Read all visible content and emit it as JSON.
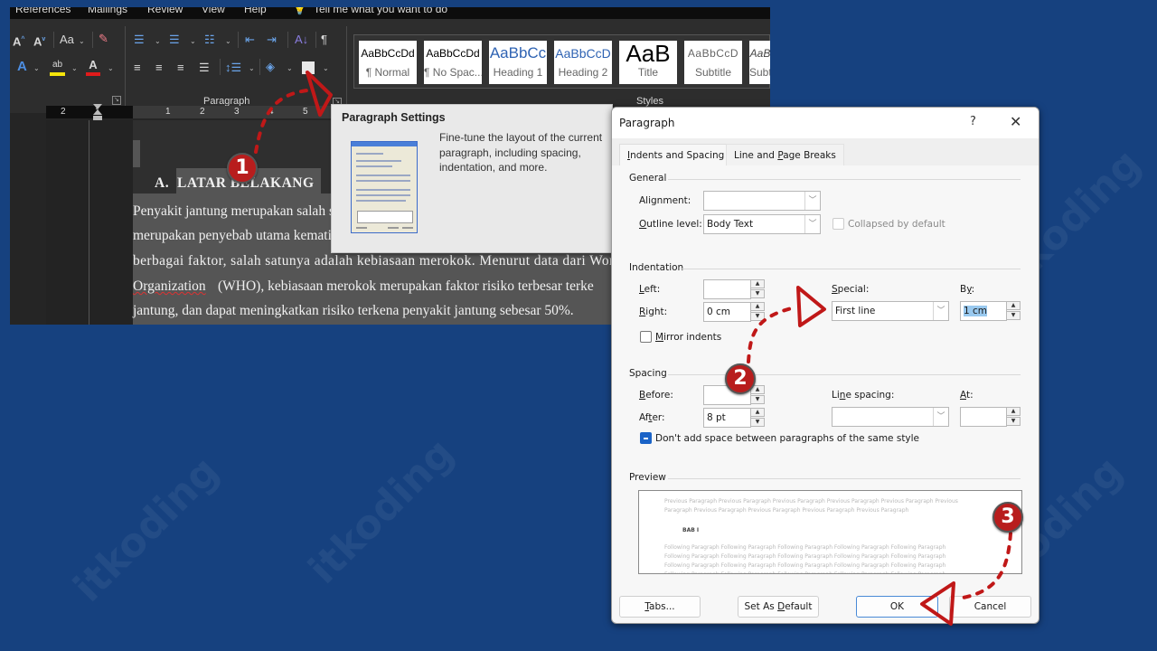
{
  "colors": {
    "background": "#16417f",
    "annotation_red": "#b81d1d",
    "selection_highlight": "#99c9ef",
    "checkbox_accent": "#1a63c7"
  },
  "watermark": "itkoding",
  "word": {
    "menu": [
      "References",
      "Mailings",
      "Review",
      "View",
      "Help",
      "Tell me what you want to do"
    ],
    "ribbon": {
      "font_group_icons": [
        "grow-font-icon",
        "shrink-font-icon",
        "change-case-icon",
        "clear-formatting-icon",
        "text-effects-icon",
        "highlight-color-icon",
        "font-color-icon"
      ],
      "change_case_label": "Aa",
      "paragraph_group_label": "Paragraph",
      "styles_group_label": "Styles",
      "styles": [
        {
          "sample": "AaBbCcDd",
          "name": "¶ Normal"
        },
        {
          "sample": "AaBbCcDd",
          "name": "¶ No Spac..."
        },
        {
          "sample": "AaBbCc",
          "name": "Heading 1"
        },
        {
          "sample": "AaBbCcD",
          "name": "Heading 2"
        },
        {
          "sample": "AaB",
          "name": "Title"
        },
        {
          "sample": "AaBbCcD",
          "name": "Subtitle"
        },
        {
          "sample": "AaB",
          "name": "Subt"
        }
      ]
    },
    "ruler_ticks": [
      "2",
      "1",
      "1",
      "2",
      "3",
      "4",
      "5"
    ],
    "document": {
      "heading_prefix": "A.",
      "heading": "LATAR BELAKANG",
      "lines": [
        "Penyakit jantung merupakan salah satu",
        "merupakan penyebab utama kematian",
        "berbagai faktor, salah satunya adalah kebiasaan merokok. Menurut data dari World",
        "Organization",
        "(WHO), kebiasaan merokok merupakan faktor risiko terbesar terke",
        "jantung, dan dapat meningkatkan risiko terkena penyakit jantung sebesar 50%."
      ]
    }
  },
  "tooltip": {
    "title": "Paragraph Settings",
    "description": "Fine-tune the layout of the current paragraph, including spacing, indentation, and more."
  },
  "dialog": {
    "title": "Paragraph",
    "help": "?",
    "close": "✕",
    "tabs": [
      {
        "pre": "",
        "key": "I",
        "post": "ndents and Spacing",
        "active": true
      },
      {
        "pre": "Line and ",
        "key": "P",
        "post": "age Breaks",
        "active": false
      }
    ],
    "general": {
      "section": "General",
      "alignment_label": "Alignment:",
      "alignment_value": "",
      "outline_label": "Outline level:",
      "outline_value": "Body Text",
      "collapsed_label": "Collapsed by default",
      "collapsed_checked": false
    },
    "indentation": {
      "section": "Indentation",
      "left_label": "Left:",
      "left_value": "",
      "right_label": "Right:",
      "right_value": "0 cm",
      "special_label": "Special:",
      "special_value": "First line",
      "by_label": "By:",
      "by_value": "1 cm",
      "mirror_label": "Mirror indents",
      "mirror_checked": false
    },
    "spacing": {
      "section": "Spacing",
      "before_label": "Before:",
      "before_value": "",
      "after_label": "After:",
      "after_value": "8 pt",
      "line_spacing_label": "Line spacing:",
      "line_spacing_value": "",
      "at_label": "At:",
      "at_value": "",
      "dont_add_label": "Don't add space between paragraphs of the same style",
      "dont_add_state": "indeterminate"
    },
    "preview": {
      "section": "Preview",
      "previous": "Previous Paragraph Previous Paragraph Previous Paragraph Previous Paragraph Previous Paragraph Previous Paragraph Previous Paragraph Previous Paragraph Previous Paragraph Previous Paragraph",
      "sample": "BAB I",
      "following": "Following Paragraph Following Paragraph Following Paragraph Following Paragraph Following Paragraph Following Paragraph Following Paragraph Following Paragraph Following Paragraph Following Paragraph Following Paragraph Following Paragraph Following Paragraph Following Paragraph Following Paragraph Following Paragraph Following Paragraph Following Paragraph Following Paragraph Following Paragraph Following Paragraph Following Paragraph"
    },
    "buttons": {
      "tabs": "Tabs...",
      "set_default": "Set As Default",
      "ok": "OK",
      "cancel": "Cancel"
    }
  },
  "annotations": {
    "steps": [
      "1",
      "2",
      "3"
    ]
  }
}
